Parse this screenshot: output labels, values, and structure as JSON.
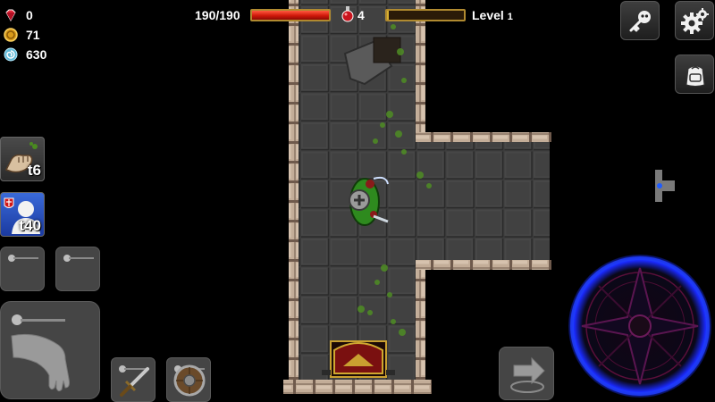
{
  "resources": {
    "gems": {
      "icon": "red-gem-icon",
      "value": "0"
    },
    "gold": {
      "icon": "gold-coin-icon",
      "value": "71"
    },
    "souls": {
      "icon": "blue-swirl-icon",
      "value": "630"
    }
  },
  "hud": {
    "hp_text": "190/190",
    "hp_fraction": 1.0,
    "potion_icon": "health-potion-icon",
    "potion_count": "4",
    "xp_fraction": 0.02,
    "level_label": "Level",
    "level_number": "1"
  },
  "skills": [
    {
      "name": "power-strike",
      "icon": "fist-icon",
      "count": "t6"
    },
    {
      "name": "shield-ally",
      "icon": "knight-shield-icon",
      "count": "t40"
    }
  ],
  "top_right": {
    "key_icon": "skull-key-icon",
    "settings_icon": "gear-icon",
    "backpack_icon": "backpack-icon"
  },
  "equipment": {
    "weapon_icon": "sword-icon",
    "shield_icon": "round-shield-icon"
  },
  "colors": {
    "hp_bar": "#d0180a",
    "bar_border": "#b08a30",
    "joystick_ring": "#1a3cff",
    "floor": "#3e3e3e",
    "wall": "#b8a08c",
    "moss": "#4a8a20"
  },
  "minimap": {
    "player_marker_color": "#1f5cff"
  },
  "move_joystick_icon": "pentagram-joystick-icon",
  "swap_button_icon": "swap-arrow-icon",
  "grab_button_icon": "hand-icon"
}
